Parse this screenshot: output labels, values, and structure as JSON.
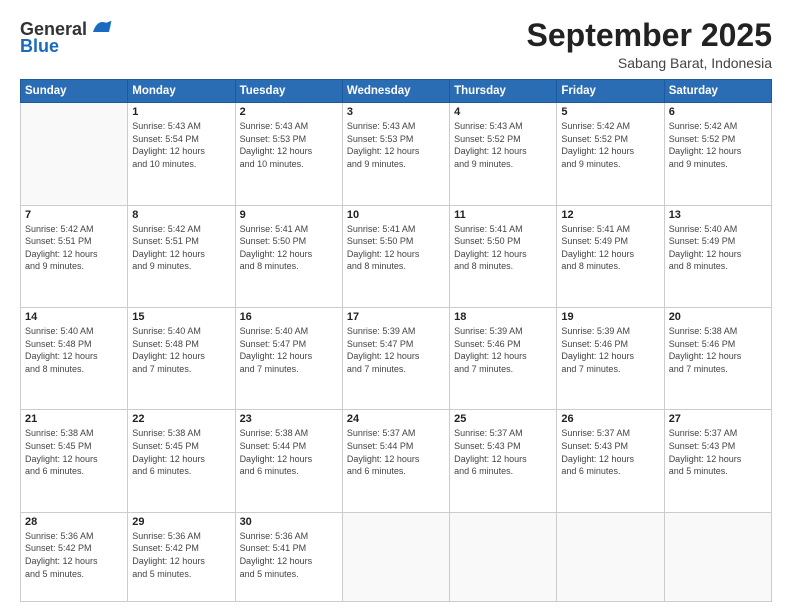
{
  "header": {
    "logo_line1": "General",
    "logo_line2": "Blue",
    "month": "September 2025",
    "location": "Sabang Barat, Indonesia"
  },
  "days_of_week": [
    "Sunday",
    "Monday",
    "Tuesday",
    "Wednesday",
    "Thursday",
    "Friday",
    "Saturday"
  ],
  "weeks": [
    [
      {
        "day": "",
        "info": ""
      },
      {
        "day": "1",
        "info": "Sunrise: 5:43 AM\nSunset: 5:54 PM\nDaylight: 12 hours\nand 10 minutes."
      },
      {
        "day": "2",
        "info": "Sunrise: 5:43 AM\nSunset: 5:53 PM\nDaylight: 12 hours\nand 10 minutes."
      },
      {
        "day": "3",
        "info": "Sunrise: 5:43 AM\nSunset: 5:53 PM\nDaylight: 12 hours\nand 9 minutes."
      },
      {
        "day": "4",
        "info": "Sunrise: 5:43 AM\nSunset: 5:52 PM\nDaylight: 12 hours\nand 9 minutes."
      },
      {
        "day": "5",
        "info": "Sunrise: 5:42 AM\nSunset: 5:52 PM\nDaylight: 12 hours\nand 9 minutes."
      },
      {
        "day": "6",
        "info": "Sunrise: 5:42 AM\nSunset: 5:52 PM\nDaylight: 12 hours\nand 9 minutes."
      }
    ],
    [
      {
        "day": "7",
        "info": "Sunrise: 5:42 AM\nSunset: 5:51 PM\nDaylight: 12 hours\nand 9 minutes."
      },
      {
        "day": "8",
        "info": "Sunrise: 5:42 AM\nSunset: 5:51 PM\nDaylight: 12 hours\nand 9 minutes."
      },
      {
        "day": "9",
        "info": "Sunrise: 5:41 AM\nSunset: 5:50 PM\nDaylight: 12 hours\nand 8 minutes."
      },
      {
        "day": "10",
        "info": "Sunrise: 5:41 AM\nSunset: 5:50 PM\nDaylight: 12 hours\nand 8 minutes."
      },
      {
        "day": "11",
        "info": "Sunrise: 5:41 AM\nSunset: 5:50 PM\nDaylight: 12 hours\nand 8 minutes."
      },
      {
        "day": "12",
        "info": "Sunrise: 5:41 AM\nSunset: 5:49 PM\nDaylight: 12 hours\nand 8 minutes."
      },
      {
        "day": "13",
        "info": "Sunrise: 5:40 AM\nSunset: 5:49 PM\nDaylight: 12 hours\nand 8 minutes."
      }
    ],
    [
      {
        "day": "14",
        "info": "Sunrise: 5:40 AM\nSunset: 5:48 PM\nDaylight: 12 hours\nand 8 minutes."
      },
      {
        "day": "15",
        "info": "Sunrise: 5:40 AM\nSunset: 5:48 PM\nDaylight: 12 hours\nand 7 minutes."
      },
      {
        "day": "16",
        "info": "Sunrise: 5:40 AM\nSunset: 5:47 PM\nDaylight: 12 hours\nand 7 minutes."
      },
      {
        "day": "17",
        "info": "Sunrise: 5:39 AM\nSunset: 5:47 PM\nDaylight: 12 hours\nand 7 minutes."
      },
      {
        "day": "18",
        "info": "Sunrise: 5:39 AM\nSunset: 5:46 PM\nDaylight: 12 hours\nand 7 minutes."
      },
      {
        "day": "19",
        "info": "Sunrise: 5:39 AM\nSunset: 5:46 PM\nDaylight: 12 hours\nand 7 minutes."
      },
      {
        "day": "20",
        "info": "Sunrise: 5:38 AM\nSunset: 5:46 PM\nDaylight: 12 hours\nand 7 minutes."
      }
    ],
    [
      {
        "day": "21",
        "info": "Sunrise: 5:38 AM\nSunset: 5:45 PM\nDaylight: 12 hours\nand 6 minutes."
      },
      {
        "day": "22",
        "info": "Sunrise: 5:38 AM\nSunset: 5:45 PM\nDaylight: 12 hours\nand 6 minutes."
      },
      {
        "day": "23",
        "info": "Sunrise: 5:38 AM\nSunset: 5:44 PM\nDaylight: 12 hours\nand 6 minutes."
      },
      {
        "day": "24",
        "info": "Sunrise: 5:37 AM\nSunset: 5:44 PM\nDaylight: 12 hours\nand 6 minutes."
      },
      {
        "day": "25",
        "info": "Sunrise: 5:37 AM\nSunset: 5:43 PM\nDaylight: 12 hours\nand 6 minutes."
      },
      {
        "day": "26",
        "info": "Sunrise: 5:37 AM\nSunset: 5:43 PM\nDaylight: 12 hours\nand 6 minutes."
      },
      {
        "day": "27",
        "info": "Sunrise: 5:37 AM\nSunset: 5:43 PM\nDaylight: 12 hours\nand 5 minutes."
      }
    ],
    [
      {
        "day": "28",
        "info": "Sunrise: 5:36 AM\nSunset: 5:42 PM\nDaylight: 12 hours\nand 5 minutes."
      },
      {
        "day": "29",
        "info": "Sunrise: 5:36 AM\nSunset: 5:42 PM\nDaylight: 12 hours\nand 5 minutes."
      },
      {
        "day": "30",
        "info": "Sunrise: 5:36 AM\nSunset: 5:41 PM\nDaylight: 12 hours\nand 5 minutes."
      },
      {
        "day": "",
        "info": ""
      },
      {
        "day": "",
        "info": ""
      },
      {
        "day": "",
        "info": ""
      },
      {
        "day": "",
        "info": ""
      }
    ]
  ]
}
